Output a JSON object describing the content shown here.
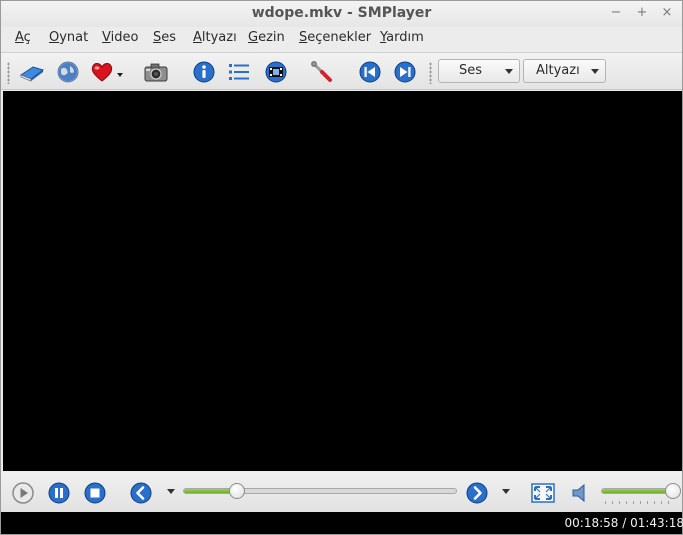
{
  "window": {
    "title": "wdope.mkv - SMPlayer",
    "controls": {
      "minimize": "−",
      "maximize": "+",
      "close": "×"
    }
  },
  "menubar": {
    "items": [
      {
        "label": "Aç",
        "accel": "A",
        "rest": "ç"
      },
      {
        "label": "Oynat",
        "accel": "O",
        "rest": "ynat"
      },
      {
        "label": "Video",
        "accel": "V",
        "rest": "ideo"
      },
      {
        "label": "Ses",
        "accel": "S",
        "rest": "es"
      },
      {
        "label": "Altyazı",
        "accel": "A",
        "rest": "ltyazı"
      },
      {
        "label": "Gezin",
        "accel": "G",
        "rest": "ezin"
      },
      {
        "label": "Seçenekler",
        "accel": "S",
        "rest": "eçenekler"
      },
      {
        "label": "Yardım",
        "accel": "Y",
        "rest": "ardım"
      }
    ]
  },
  "toolbar": {
    "icons": [
      "open-file-icon",
      "open-url-icon",
      "favorites-icon",
      "screenshot-icon",
      "info-icon",
      "playlist-icon",
      "video-preferences-icon",
      "preferences-icon",
      "previous-icon",
      "next-icon"
    ],
    "audio_combo": "Ses",
    "subtitle_combo": "Altyazı"
  },
  "controlbar": {
    "seek_progress": 0.195,
    "volume": 0.99
  },
  "statusbar": {
    "time": "00:18:58 / 01:43:18"
  },
  "colors": {
    "accent_blue": "#2a6fc9",
    "progress_green": "#7fbf3a",
    "video_background": "#000000"
  }
}
